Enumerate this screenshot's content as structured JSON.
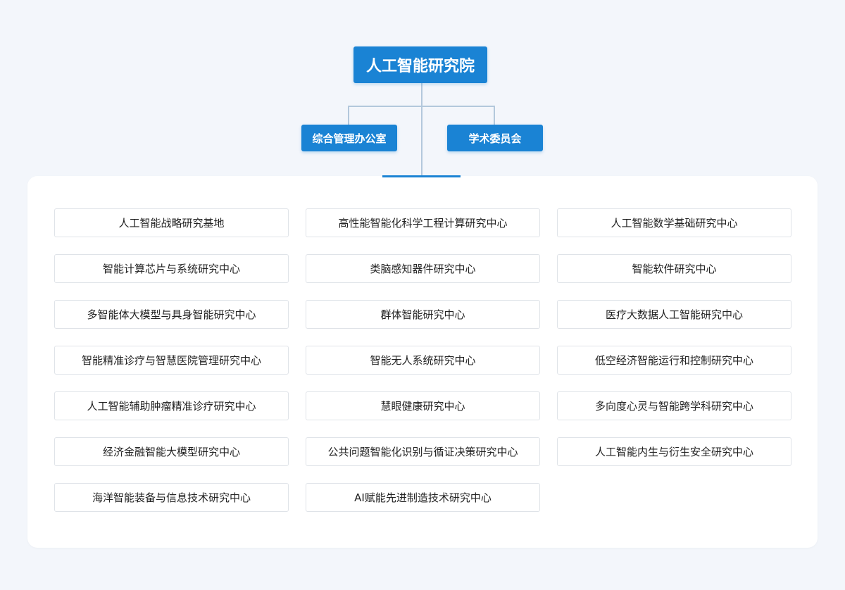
{
  "root": {
    "label": "人工智能研究院"
  },
  "branches": [
    {
      "label": "综合管理办公室"
    },
    {
      "label": "学术委员会"
    }
  ],
  "centers": [
    "人工智能战略研究基地",
    "高性能智能化科学工程计算研究中心",
    "人工智能数学基础研究中心",
    "智能计算芯片与系统研究中心",
    "类脑感知器件研究中心",
    "智能软件研究中心",
    "多智能体大模型与具身智能研究中心",
    "群体智能研究中心",
    "医疗大数据人工智能研究中心",
    "智能精准诊疗与智慧医院管理研究中心",
    "智能无人系统研究中心",
    "低空经济智能运行和控制研究中心",
    "人工智能辅助肿瘤精准诊疗研究中心",
    "慧眼健康研究中心",
    "多向度心灵与智能跨学科研究中心",
    "经济金融智能大模型研究中心",
    "公共问题智能化识别与循证决策研究中心",
    "人工智能内生与衍生安全研究中心",
    "海洋智能装备与信息技术研究中心",
    "AI赋能先进制造技术研究中心"
  ],
  "colors": {
    "node": "#1a83d4",
    "connector": "#b3c8dc",
    "background": "#f3f6fb",
    "cell_border": "#dfe3e8"
  }
}
